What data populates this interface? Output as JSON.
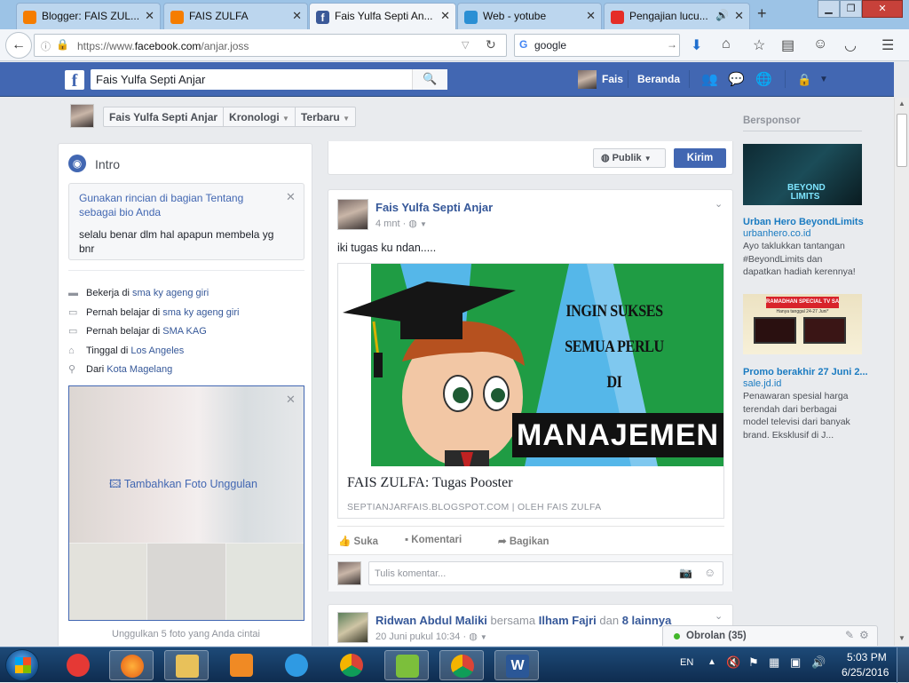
{
  "browser": {
    "tabs": [
      {
        "title": "Blogger: FAIS ZUL...",
        "icon": "blogger-icon"
      },
      {
        "title": "FAIS ZULFA",
        "icon": "blogger-icon"
      },
      {
        "title": "Fais Yulfa Septi An...",
        "icon": "facebook-icon"
      },
      {
        "title": "Web - yotube",
        "icon": "web-icon"
      },
      {
        "title": "Pengajian lucu...",
        "icon": "youtube-icon"
      }
    ],
    "url_prefix": "https://www.",
    "url_domain": "facebook.com",
    "url_path": "/anjar.joss",
    "search_value": "google"
  },
  "fb": {
    "search_value": "Fais Yulfa Septi Anjar",
    "user_short": "Fais",
    "home_label": "Beranda",
    "sticky": {
      "name": "Fais Yulfa Septi Anjar",
      "timeline": "Kronologi",
      "recent": "Terbaru"
    },
    "intro": {
      "title": "Intro",
      "prompt": "Gunakan rincian di bagian Tentang sebagai bio Anda",
      "bio": "selalu benar dlm hal apapun membela yg bnr",
      "items": [
        {
          "prefix": "Bekerja di ",
          "link": "sma ky ageng giri",
          "icon": "briefcase-icon"
        },
        {
          "prefix": "Pernah belajar di ",
          "link": "sma ky ageng giri",
          "icon": "graduation-cap-icon"
        },
        {
          "prefix": "Pernah belajar di ",
          "link": "SMA KAG",
          "icon": "graduation-cap-icon"
        },
        {
          "prefix": "Tinggal di ",
          "link": "Los Angeles",
          "icon": "home-icon"
        },
        {
          "prefix": "Dari ",
          "link": "Kota Magelang",
          "icon": "location-pin-icon"
        }
      ],
      "featured_label": "Tambahkan Foto Unggulan",
      "featured_hint": "Unggulkan 5 foto yang Anda cintai"
    },
    "composer": {
      "privacy": "Publik",
      "send": "Kirim"
    },
    "post": {
      "author": "Fais Yulfa Septi Anjar",
      "time": "4 mnt",
      "text": "iki tugas ku ndan.....",
      "image_lines": [
        "INGIN SUKSES",
        "SEMUA PERLU",
        "DI"
      ],
      "image_big": "MANAJEMEN",
      "link_title": "FAIS ZULFA: Tugas Pooster",
      "link_source": "SEPTIANJARFAIS.BLOGSPOT.COM",
      "link_separator": "|",
      "link_by": "OLEH FAIS ZULFA",
      "like": "Suka",
      "comment": "Komentari",
      "share": "Bagikan",
      "comment_placeholder": "Tulis komentar..."
    },
    "post2": {
      "author": "Ridwan Abdul Maliki",
      "with": " bersama ",
      "tagged": "Ilham Fajri",
      "and": " dan ",
      "others": "8 lainnya",
      "time": "20 Juni pukul 10:34"
    },
    "sponsored": {
      "header": "Bersponsor",
      "ads": [
        {
          "title": "Urban Hero BeyondLimits",
          "domain": "urbanhero.co.id",
          "body": "Ayo taklukkan tantangan #BeyondLimits dan dapatkan hadiah kerennya!",
          "image_text": "BEYOND LIMITS"
        },
        {
          "title": "Promo berakhir 27 Juni 2...",
          "domain": "sale.jd.id",
          "body": "Penawaran spesial harga terendah dari berbagai model televisi dari banyak brand. Eksklusif di J...",
          "image_text": "RAMADHAN SPECIAL TV SALE",
          "image_sub": "Hanya tanggal 24-27 Juni*"
        }
      ]
    },
    "chat": "Obrolan (35)"
  },
  "taskbar": {
    "lang": "EN",
    "time": "5:03 PM",
    "date": "6/25/2016"
  },
  "colors": {
    "fb_blue": "#4267b2",
    "link": "#365899",
    "ad_link": "#1a7bc1",
    "poster_green": "#1f9c44",
    "poster_sky": "#55b7e9"
  }
}
